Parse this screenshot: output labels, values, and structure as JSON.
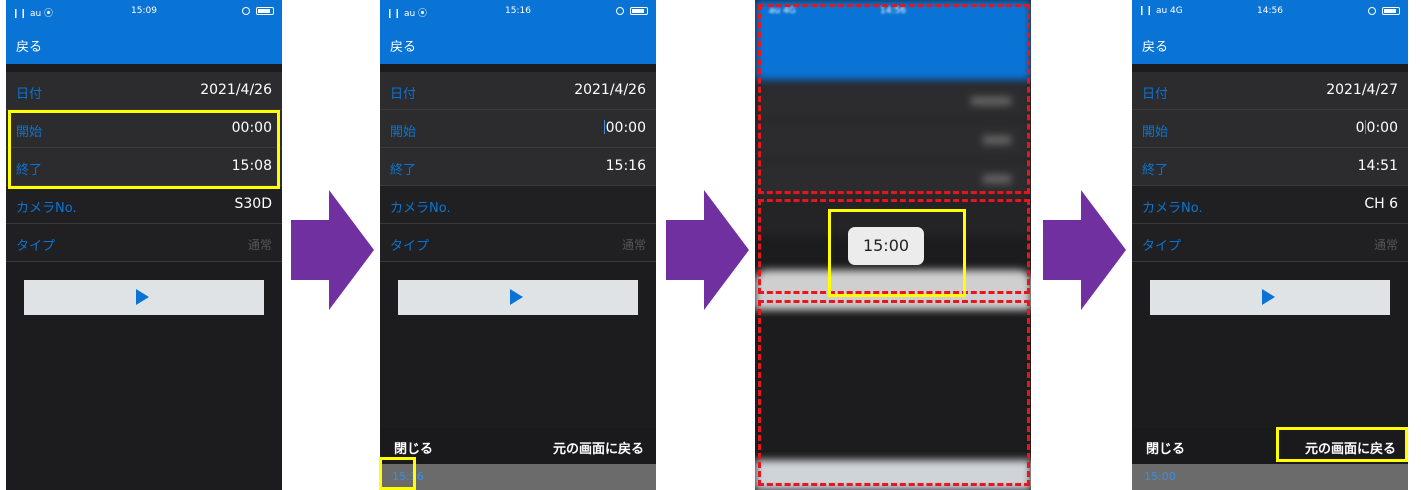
{
  "colors": {
    "nav_blue": "#0a74d6",
    "highlight": "#ffff00",
    "arrow": "#7030a0",
    "dashed_red": "#e8141e"
  },
  "screens": [
    {
      "status": {
        "carrier": "❙❙ au ⦿",
        "clock": "15:09"
      },
      "back": "戻る",
      "rows": [
        {
          "label": "日付",
          "value": "2021/4/26"
        },
        {
          "label": "開始",
          "value": "00:00"
        },
        {
          "label": "終了",
          "value": "15:08"
        },
        {
          "label": "カメラNo.",
          "value": "S30D"
        },
        {
          "label": "タイプ",
          "value": "通常"
        }
      ]
    },
    {
      "status": {
        "carrier": "❙❙ au ⦿",
        "clock": "15:16"
      },
      "back": "戻る",
      "rows": [
        {
          "label": "日付",
          "value": "2021/4/26"
        },
        {
          "label": "開始",
          "value": "00:00"
        },
        {
          "label": "終了",
          "value": "15:16"
        },
        {
          "label": "カメラNo.",
          "value": ""
        },
        {
          "label": "タイプ",
          "value": "通常"
        }
      ],
      "toolbar": {
        "close": "閉じる",
        "back_original": "元の画面に戻る"
      },
      "picker_time": "15:16"
    },
    {
      "status": {
        "carrier": "au 4G",
        "clock": "14:56"
      },
      "popup_time": "15:00"
    },
    {
      "status": {
        "carrier": "❙❙ au 4G",
        "clock": "14:56"
      },
      "back": "戻る",
      "rows": [
        {
          "label": "日付",
          "value": "2021/4/27"
        },
        {
          "label": "開始",
          "value_pre": "0",
          "value_post": "0:00"
        },
        {
          "label": "終了",
          "value": "14:51"
        },
        {
          "label": "カメラNo.",
          "value": "CH 6"
        },
        {
          "label": "タイプ",
          "value": "通常"
        }
      ],
      "toolbar": {
        "close": "閉じる",
        "back_original": "元の画面に戻る"
      },
      "picker_time": "15:00"
    }
  ]
}
